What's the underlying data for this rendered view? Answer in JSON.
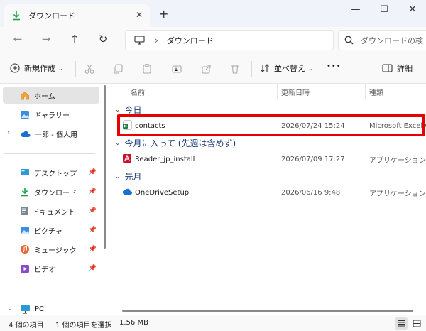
{
  "tab": {
    "title": "ダウンロード",
    "close": "✕",
    "new_tab": "+"
  },
  "window": {
    "minimize": "—",
    "maximize": "☐",
    "close": "✕"
  },
  "nav": {
    "back": "←",
    "forward": "→",
    "up": "↑",
    "refresh": "↻"
  },
  "address": {
    "separator": "›",
    "location": "ダウンロード"
  },
  "search": {
    "placeholder": "ダウンロードの検"
  },
  "commands": {
    "new_label": "新規作成",
    "sort_label": "並べ替え",
    "more": "•••",
    "details_label": "詳細"
  },
  "sidebar": {
    "home": "ホーム",
    "gallery": "ギャラリー",
    "onedrive": "一郎 - 個人用",
    "desktop": "デスクトップ",
    "downloads": "ダウンロード",
    "documents": "ドキュメント",
    "pictures": "ピクチャ",
    "music": "ミュージック",
    "videos": "ビデオ",
    "pc": "PC"
  },
  "columns": {
    "name": "名前",
    "date": "更新日時",
    "type": "種類"
  },
  "groups": {
    "today": "今日",
    "this_month": "今月に入って (先週は含めず)",
    "earlier": "先月"
  },
  "files": [
    {
      "name": "contacts",
      "date": "2026/07/24 15:24",
      "type": "Microsoft Excel C",
      "icon": "excel-csv-icon"
    },
    {
      "name": "Reader_jp_install",
      "date": "2026/07/09 17:27",
      "type": "アプリケーション",
      "icon": "adobe-installer-icon"
    },
    {
      "name": "OneDriveSetup",
      "date": "2026/06/16 9:48",
      "type": "アプリケーション",
      "icon": "onedrive-icon"
    }
  ],
  "status": {
    "count": "4 個の項目",
    "selected": "1 個の項目を選択",
    "size": "1.56 MB"
  },
  "colors": {
    "highlight": "#e60000",
    "accent": "#1a6fd1",
    "group": "#1a3a78"
  }
}
